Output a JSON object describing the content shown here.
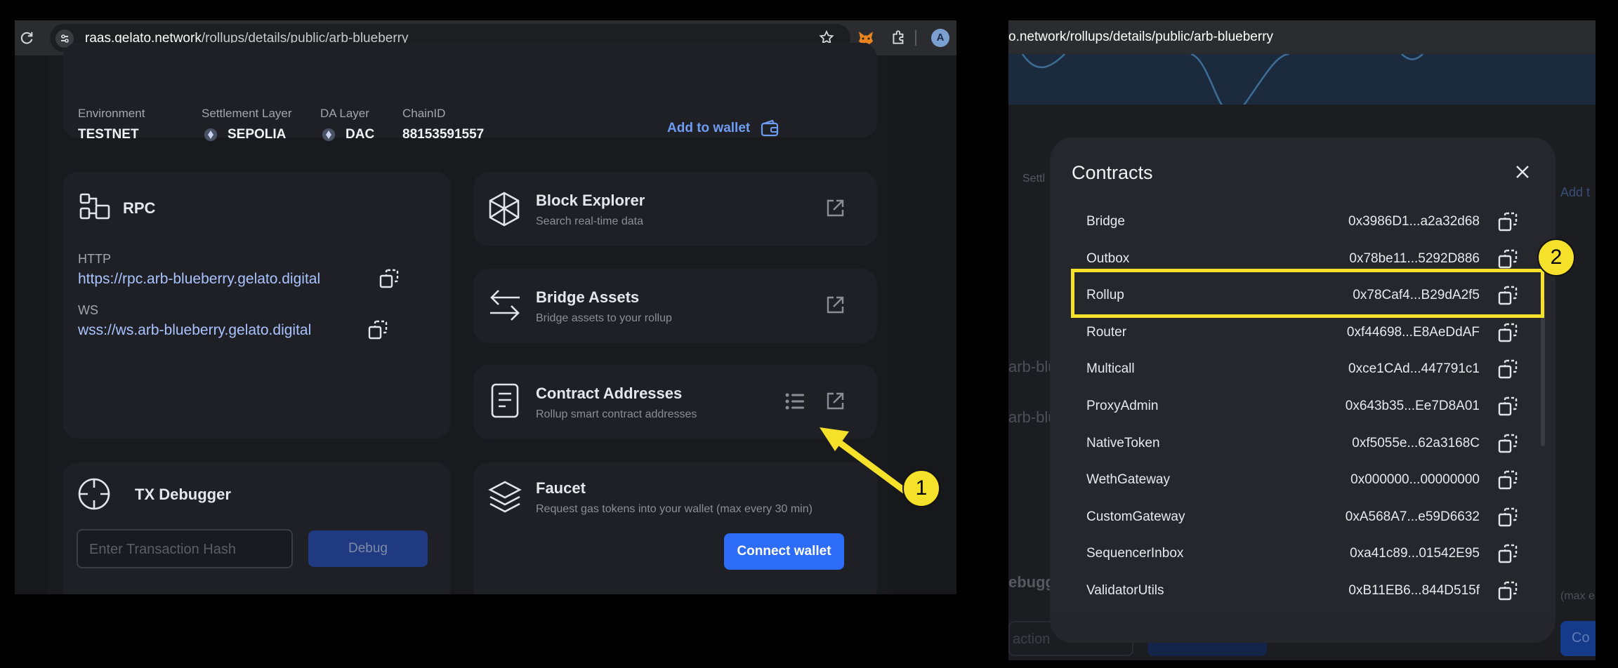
{
  "left": {
    "browser": {
      "url_host": "raas.gelato.network",
      "url_path": "/rollups/details/public/arb-blueberry",
      "profile_initial": "A"
    },
    "info": {
      "environment_label": "Environment",
      "environment_value": "TESTNET",
      "settlement_label": "Settlement Layer",
      "settlement_value": "SEPOLIA",
      "da_label": "DA Layer",
      "da_value": "DAC",
      "chain_label": "ChainID",
      "chain_value": "88153591557",
      "add_wallet": "Add to wallet"
    },
    "rpc": {
      "title": "RPC",
      "http_label": "HTTP",
      "http_url": "https://rpc.arb-blueberry.gelato.digital",
      "ws_label": "WS",
      "ws_url": "wss://ws.arb-blueberry.gelato.digital"
    },
    "block_explorer": {
      "title": "Block Explorer",
      "subtitle": "Search real-time data"
    },
    "bridge": {
      "title": "Bridge Assets",
      "subtitle": "Bridge assets to your rollup"
    },
    "contracts_card": {
      "title": "Contract Addresses",
      "subtitle": "Rollup smart contract addresses"
    },
    "tx_debugger": {
      "title": "TX Debugger",
      "placeholder": "Enter Transaction Hash",
      "button": "Debug"
    },
    "faucet": {
      "title": "Faucet",
      "subtitle": "Request gas tokens into your wallet (max every 30 min)",
      "button": "Connect wallet"
    },
    "callout": "1"
  },
  "right": {
    "browser": {
      "url_fragment": "o.network/rollups/details/public/arb-blueberry"
    },
    "bg_fragments": {
      "settle": "Settl",
      "add": "Add t",
      "arb1": "arb-blu",
      "arb2": "arb-blue",
      "debug": "ebugg",
      "max": "(max e",
      "input": "action",
      "con": "Co"
    },
    "modal": {
      "title": "Contracts",
      "rows": [
        {
          "name": "Bridge",
          "address": "0x3986D1...a2a32d68"
        },
        {
          "name": "Outbox",
          "address": "0x78be11...5292D886"
        },
        {
          "name": "Rollup",
          "address": "0x78Caf4...B29dA2f5"
        },
        {
          "name": "Router",
          "address": "0xf44698...E8AeDdAF"
        },
        {
          "name": "Multicall",
          "address": "0xce1CAd...447791c1"
        },
        {
          "name": "ProxyAdmin",
          "address": "0x643b35...Ee7D8A01"
        },
        {
          "name": "NativeToken",
          "address": "0xf5055e...62a3168C"
        },
        {
          "name": "WethGateway",
          "address": "0x000000...00000000"
        },
        {
          "name": "CustomGateway",
          "address": "0xA568A7...e59D6632"
        },
        {
          "name": "SequencerInbox",
          "address": "0xa41c89...01542E95"
        },
        {
          "name": "ValidatorUtils",
          "address": "0xB11EB6...844D515f"
        }
      ]
    },
    "callout": "2"
  },
  "colors": {
    "accent_blue": "#2d6cf6",
    "callout_yellow": "#f5e02a",
    "link_blue": "#6f9cf3"
  }
}
